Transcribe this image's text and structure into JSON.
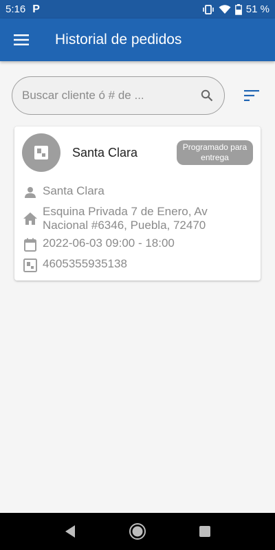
{
  "status_bar": {
    "time": "5:16",
    "notification": "P",
    "battery": "51 %"
  },
  "app_bar": {
    "title": "Historial de pedidos"
  },
  "search": {
    "placeholder": "Buscar cliente ó # de ..."
  },
  "order": {
    "name": "Santa Clara",
    "status": "Programado para entrega",
    "customer": "Santa Clara",
    "address_line1": "Esquina Privada 7 de Enero, Av",
    "address_line2": "Nacional #6346, Puebla, 72470",
    "schedule": "2022-06-03 09:00 - 18:00",
    "order_number": "4605355935138"
  },
  "colors": {
    "primary": "#2065b3",
    "status_bar": "#1e5aa0",
    "badge": "#9e9e9e"
  }
}
